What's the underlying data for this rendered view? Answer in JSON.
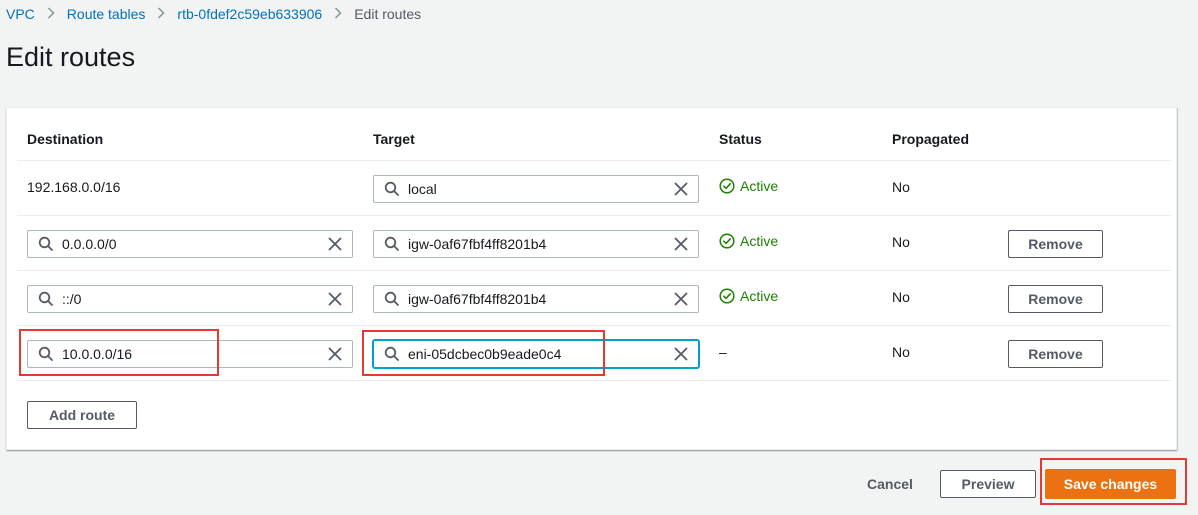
{
  "breadcrumb": {
    "items": [
      "VPC",
      "Route tables",
      "rtb-0fdef2c59eb633906"
    ],
    "current": "Edit routes"
  },
  "page": {
    "title": "Edit routes"
  },
  "table": {
    "headers": {
      "destination": "Destination",
      "target": "Target",
      "status": "Status",
      "propagated": "Propagated"
    },
    "rows": [
      {
        "destination": "192.168.0.0/16",
        "target": "local",
        "status": "Active",
        "propagated": "No"
      },
      {
        "destination": "0.0.0.0/0",
        "target": "igw-0af67fbf4ff8201b4",
        "status": "Active",
        "propagated": "No",
        "remove_label": "Remove"
      },
      {
        "destination": "::/0",
        "target": "igw-0af67fbf4ff8201b4",
        "status": "Active",
        "propagated": "No",
        "remove_label": "Remove"
      },
      {
        "destination": "10.0.0.0/16",
        "target": "eni-05dcbec0b9eade0c4",
        "status": "–",
        "propagated": "No",
        "remove_label": "Remove"
      }
    ],
    "add_route_label": "Add route"
  },
  "footer": {
    "cancel_label": "Cancel",
    "preview_label": "Preview",
    "save_label": "Save changes"
  },
  "colors": {
    "link": "#0073bb",
    "active_status": "#1d8102",
    "primary": "#ec7211",
    "highlight": "#e53935",
    "focus": "#00a1c9"
  }
}
